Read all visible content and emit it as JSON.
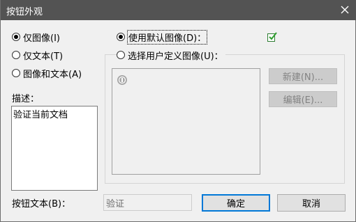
{
  "window": {
    "title": "按钮外观",
    "close_icon": "close-icon"
  },
  "display_options": [
    {
      "label": "仅图像(I)",
      "checked": true
    },
    {
      "label": "仅文本(T)",
      "checked": false
    },
    {
      "label": "图像和文本(A)",
      "checked": false
    }
  ],
  "image_options": [
    {
      "label": "使用默认图像(D)：",
      "checked": true
    },
    {
      "label": "选择用户定义图像(U)：",
      "checked": false
    }
  ],
  "description": {
    "label": "描述：",
    "text": "验证当前文档"
  },
  "image_buttons": {
    "new_label": "新建(N)...",
    "edit_label": "编辑(E)..."
  },
  "button_text": {
    "label": "按钮文本(B)：",
    "value": "验证"
  },
  "actions": {
    "ok_label": "确定",
    "cancel_label": "取消"
  },
  "icons": {
    "default_image": "check-document-icon",
    "user_image_placeholder": "user-image-icon"
  },
  "colors": {
    "titlebar": "#535353",
    "default_button_border": "#0078d7"
  }
}
